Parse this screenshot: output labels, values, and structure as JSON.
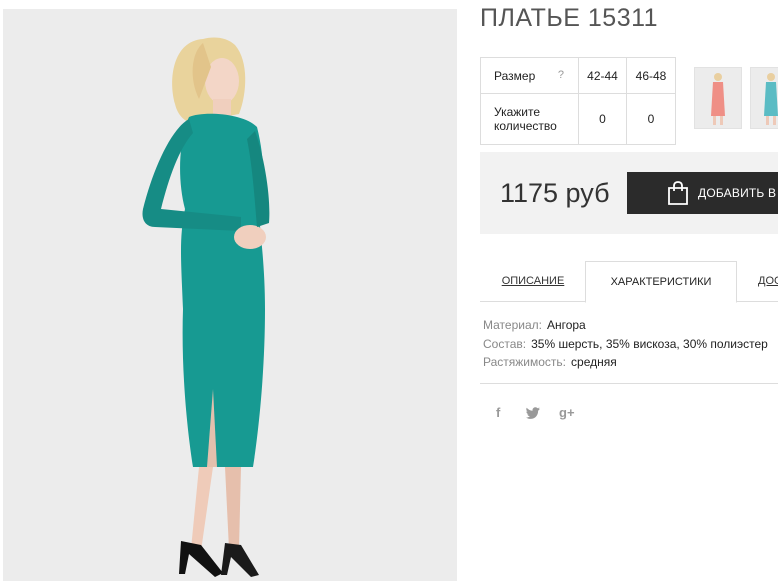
{
  "product": {
    "title": "ПЛАТЬЕ 15311",
    "price": "1175 руб"
  },
  "size_table": {
    "size_label": "Размер",
    "help_symbol": "?",
    "sizes": [
      "42-44",
      "46-48"
    ],
    "quantity_label": "Укажите количество",
    "quantities": [
      "0",
      "0"
    ]
  },
  "thumbnails": [
    {
      "icon": "thumbnail-coral-dress"
    },
    {
      "icon": "thumbnail-teal-dress"
    }
  ],
  "cart": {
    "button_label": "ДОБАВИТЬ В З",
    "icon": "shopping-bag-icon"
  },
  "tabs": {
    "description": "ОПИСАНИЕ",
    "characteristics": "ХАРАКТЕРИСТИКИ",
    "delivery": "ДОС"
  },
  "specs": [
    {
      "key": "Материал:",
      "value": "Ангора"
    },
    {
      "key": "Состав:",
      "value": "35% шерсть, 35% вискоза, 30% полиэстер"
    },
    {
      "key": "Растяжимость:",
      "value": "средняя"
    }
  ],
  "social": {
    "facebook": "f",
    "twitter": "twitter-bird-icon",
    "google": "g+"
  },
  "colors": {
    "dress_teal": "#179a92",
    "dress_coral": "#ef8f86",
    "button_dark": "#2b2b2b",
    "price_bg": "#f2f2f2"
  }
}
